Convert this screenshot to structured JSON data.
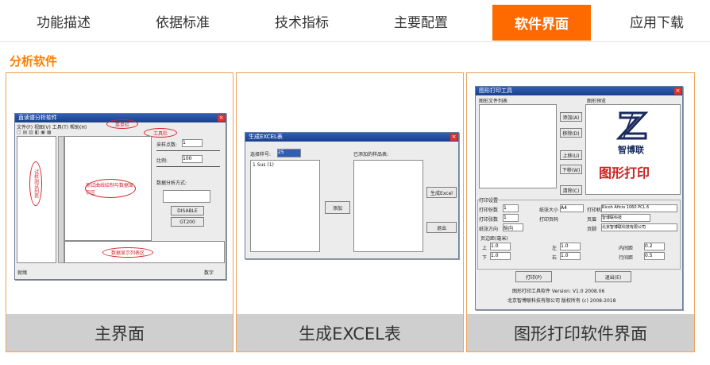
{
  "tabs": [
    "功能描述",
    "依据标准",
    "技术指标",
    "主要配置",
    "软件界面",
    "应用下载"
  ],
  "active_tab": "软件界面",
  "section_title": "分析软件",
  "panels": [
    {
      "caption": "主界面",
      "window": {
        "title": "直读谱分析软件",
        "menu": "文件(F)  视图(V)  工具(T)  帮助(H)",
        "left_note": "试样测试列表",
        "top_note": "菜单栏",
        "tool_note": "工具栏",
        "center_note": "测试曲线绘制与数据显示区",
        "bottom_note": "数据显示列表区",
        "param_a_label": "采样点数:",
        "param_a_value": "1",
        "param_b_label": "比例:",
        "param_b_value": "100",
        "combo_label": "数据分析方式:",
        "btn_1": "DISABLE",
        "btn_2": "GT200",
        "statusbar_left": "就绪",
        "statusbar_right": "数字"
      }
    },
    {
      "caption": "生成EXCEL表",
      "window": {
        "title": "生成EXCEL表",
        "left_label": "选择样号:",
        "combo_value": "25",
        "right_label": "已添加的样品表:",
        "list_item": "1  Sus (1)",
        "add_btn": "添加",
        "excel_btn": "生成Excel",
        "exit_btn": "退出"
      }
    },
    {
      "caption": "图形打印软件界面",
      "window": {
        "title": "图形打印工具",
        "list_label": "图形文件列表",
        "preview_label": "图形预览",
        "side_buttons": [
          "添加(A)",
          "移除(D)",
          "上移(U)",
          "下移(W)",
          "清除(C)"
        ],
        "logo_text": "智博联",
        "red_text": "图形打印",
        "settings_label": "打印设置",
        "row1": [
          "打印份数",
          "1",
          "纸张大小",
          "A4",
          "打印机",
          "Ricoh Aficio 1060 PCL 6"
        ],
        "row2": [
          "打印张数",
          "1",
          "打印页码",
          "页眉",
          "智博联科技"
        ],
        "row3": [
          "纸张方向",
          "纵向",
          "页脚",
          "北京智博联科技有限公司"
        ],
        "margin_label": "页边距(毫米)",
        "margins": [
          "上",
          "1.0",
          "左",
          "1.0",
          "内间距",
          "0.2",
          "下",
          "1.0",
          "右",
          "1.0",
          "行间距",
          "0.5"
        ],
        "print_btn": "打印(P)",
        "exit_btn": "退出(E)",
        "footer_1": "图形打印工具软件 Version: V1.0 2008.06",
        "footer_2": "北京智博联科技有限公司  版权所有 (c) 2008-2018"
      }
    }
  ]
}
